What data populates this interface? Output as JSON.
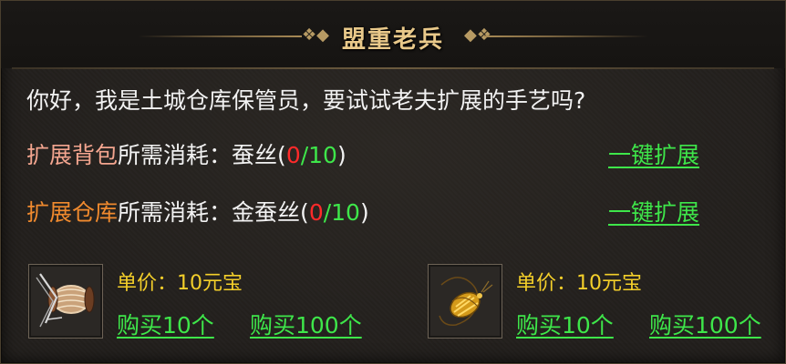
{
  "title": "盟重老兵",
  "greeting": "你好，我是土城仓库保管员，要试试老夫扩展的手艺吗?",
  "rows": [
    {
      "label": "扩展背包",
      "cost_prefix": "所需消耗：",
      "material": "蚕丝",
      "open_paren": "(",
      "current": "0",
      "slash_total": "/10",
      "close_paren": ")",
      "action": "一键扩展"
    },
    {
      "label": "扩展仓库",
      "cost_prefix": "所需消耗：",
      "material": "金蚕丝",
      "open_paren": "(",
      "current": "0",
      "slash_total": "/10",
      "close_paren": ")",
      "action": "一键扩展"
    }
  ],
  "shop": [
    {
      "icon": "silk-spool-icon",
      "price": "单价：10元宝",
      "buy10": "购买10个",
      "buy100": "购买100个"
    },
    {
      "icon": "golden-silkworm-icon",
      "price": "单价：10元宝",
      "buy10": "购买10个",
      "buy100": "购买100个"
    }
  ],
  "colors": {
    "title": "#e9c98a",
    "label_bag": "#f3a58f",
    "label_warehouse": "#f08a2e",
    "count_current": "#ff2a2a",
    "count_total": "#3ee64a",
    "link": "#3ee64a",
    "price": "#f4cf2a"
  }
}
